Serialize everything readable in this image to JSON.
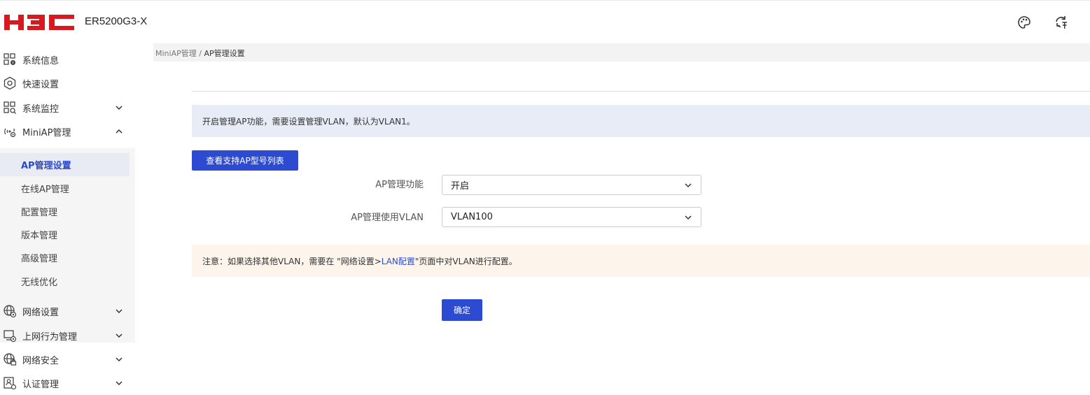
{
  "header": {
    "logo_text": "H3C",
    "device_name": "ER5200G3-X",
    "icons": [
      "palette-icon",
      "refresh-language-icon"
    ]
  },
  "sidebar": {
    "items": [
      {
        "label": "系统信息",
        "icon": "system-info-icon"
      },
      {
        "label": "快速设置",
        "icon": "quick-setup-icon"
      },
      {
        "label": "系统监控",
        "icon": "system-monitor-icon"
      },
      {
        "label": "MiniAP管理",
        "icon": "miniap-icon"
      },
      {
        "label": "网络设置",
        "icon": "network-settings-icon"
      },
      {
        "label": "上网行为管理",
        "icon": "behavior-management-icon"
      },
      {
        "label": "网络安全",
        "icon": "network-security-icon"
      },
      {
        "label": "认证管理",
        "icon": "auth-management-icon"
      }
    ],
    "submenu": [
      {
        "label": "AP管理设置",
        "active": true
      },
      {
        "label": "在线AP管理"
      },
      {
        "label": "配置管理"
      },
      {
        "label": "版本管理"
      },
      {
        "label": "高级管理"
      },
      {
        "label": "无线优化"
      }
    ]
  },
  "breadcrumb": {
    "parent": "MiniAP管理",
    "separator": " / ",
    "current": "AP管理设置"
  },
  "main": {
    "info_text": "开启管理AP功能，需要设置管理VLAN，默认为VLAN1。",
    "models_button": "查看支持AP型号列表",
    "form": {
      "ap_function_label": "AP管理功能",
      "ap_function_value": "开启",
      "vlan_label": "AP管理使用VLAN",
      "vlan_value": "VLAN100"
    },
    "note": {
      "prefix": "注意：如果选择其他VLAN，需要在 \"网络设置>",
      "link": "LAN配置",
      "suffix": "\"页面中对VLAN进行配置。"
    },
    "confirm_button": "确定"
  },
  "colors": {
    "brand_red": "#d71920",
    "primary_blue": "#2d4bd1",
    "info_bg": "#e8ecf6",
    "note_bg": "#fdf4ec"
  }
}
